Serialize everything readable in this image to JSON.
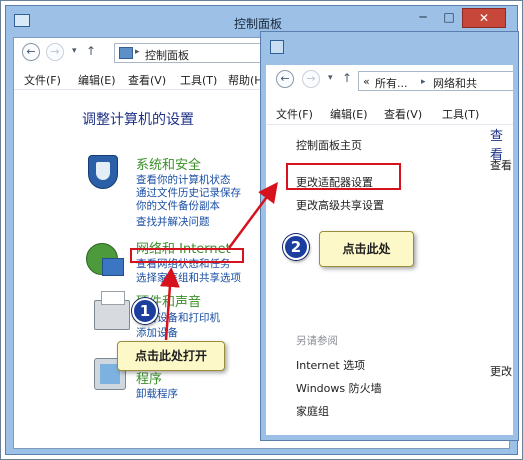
{
  "window1": {
    "title": "控制面板",
    "controls": {
      "minimize": "─",
      "maximize": "□",
      "close": "✕"
    },
    "nav": {
      "back": "←",
      "forward": "→",
      "dropdown": "▾",
      "up": "↑",
      "address_sep": "▸",
      "address": "控制面板"
    },
    "menu": [
      "文件(F)",
      "编辑(E)",
      "查看(V)",
      "工具(T)",
      "帮助(H)"
    ],
    "heading": "调整计算机的设置",
    "categories": {
      "system": {
        "title": "系统和安全",
        "links": [
          "查看你的计算机状态",
          "通过文件历史记录保存",
          "你的文件备份副本",
          "查找并解决问题"
        ]
      },
      "network": {
        "title": "网络和 Internet",
        "links": [
          "查看网络状态和任务",
          "选择家庭组和共享选项"
        ]
      },
      "hardware": {
        "title": "硬件和声音",
        "links": [
          "查看设备和打印机",
          "添加设备"
        ]
      },
      "programs": {
        "title": "程序",
        "links": [
          "卸载程序"
        ]
      }
    }
  },
  "window2": {
    "nav": {
      "back": "←",
      "forward": "→",
      "dropdown": "▾",
      "up": "↑"
    },
    "address": {
      "chevrons": "«",
      "part1": "所有...",
      "sep": "▸",
      "part2": "网络和共"
    },
    "menu": [
      "文件(F)",
      "编辑(E)",
      "查看(V)",
      "工具(T)"
    ],
    "sidebar": {
      "home": "控制面板主页",
      "links": [
        "更改适配器设置",
        "更改高级共享设置"
      ],
      "see_also_title": "另请参阅",
      "see_also": [
        "Internet 选项",
        "Windows 防火墙",
        "家庭组"
      ]
    },
    "right_clipped": {
      "heading": "查看",
      "line1": "查看",
      "line2": "更改"
    }
  },
  "annotations": {
    "step1": {
      "number": "1",
      "text": "点击此处打开"
    },
    "step2": {
      "number": "2",
      "text": "点击此处"
    },
    "colors": {
      "highlight": "#d6121c",
      "badge": "#1c3e9e",
      "callout_bg": "#fdf8c7"
    }
  }
}
